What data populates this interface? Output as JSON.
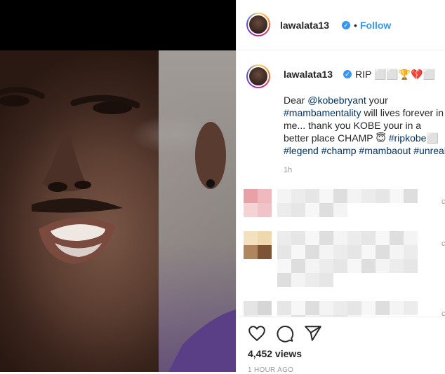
{
  "post": {
    "username": "lawalata13",
    "follow_label": "Follow",
    "separator": "•",
    "verified_glyph": "✓",
    "caption_head": "RIP ⬜⬜🏆💔⬜",
    "caption_parts": [
      {
        "text": "Dear ",
        "tag": false
      },
      {
        "text": "@kobebryant",
        "tag": true
      },
      {
        "text": " your ",
        "tag": false
      },
      {
        "text": "#mambamentality",
        "tag": true
      },
      {
        "text": " will lives forever in me... thank you KOBE your in a better place CHAMP ",
        "tag": false
      },
      {
        "text": "😇 ",
        "tag": false
      },
      {
        "text": "#ripkobe⬜",
        "tag": true
      },
      {
        "text": " ",
        "tag": false
      },
      {
        "text": "#legend",
        "tag": true
      },
      {
        "text": " ",
        "tag": false
      },
      {
        "text": "#champ",
        "tag": true
      },
      {
        "text": " ",
        "tag": false
      },
      {
        "text": "#mambaout",
        "tag": true
      },
      {
        "text": " ",
        "tag": false
      },
      {
        "text": "#unreal",
        "tag": true
      }
    ],
    "caption_age": "1h",
    "views": "4,452 views",
    "timestamp": "1 HOUR AGO"
  },
  "icons": {
    "like": "heart-icon",
    "comment": "comment-icon",
    "share": "share-icon",
    "verified": "verified-badge-icon"
  },
  "comments_edge_char": "c",
  "colors": {
    "link": "#3897f0",
    "hashtag": "#003569",
    "muted": "#999999",
    "text": "#262626"
  }
}
